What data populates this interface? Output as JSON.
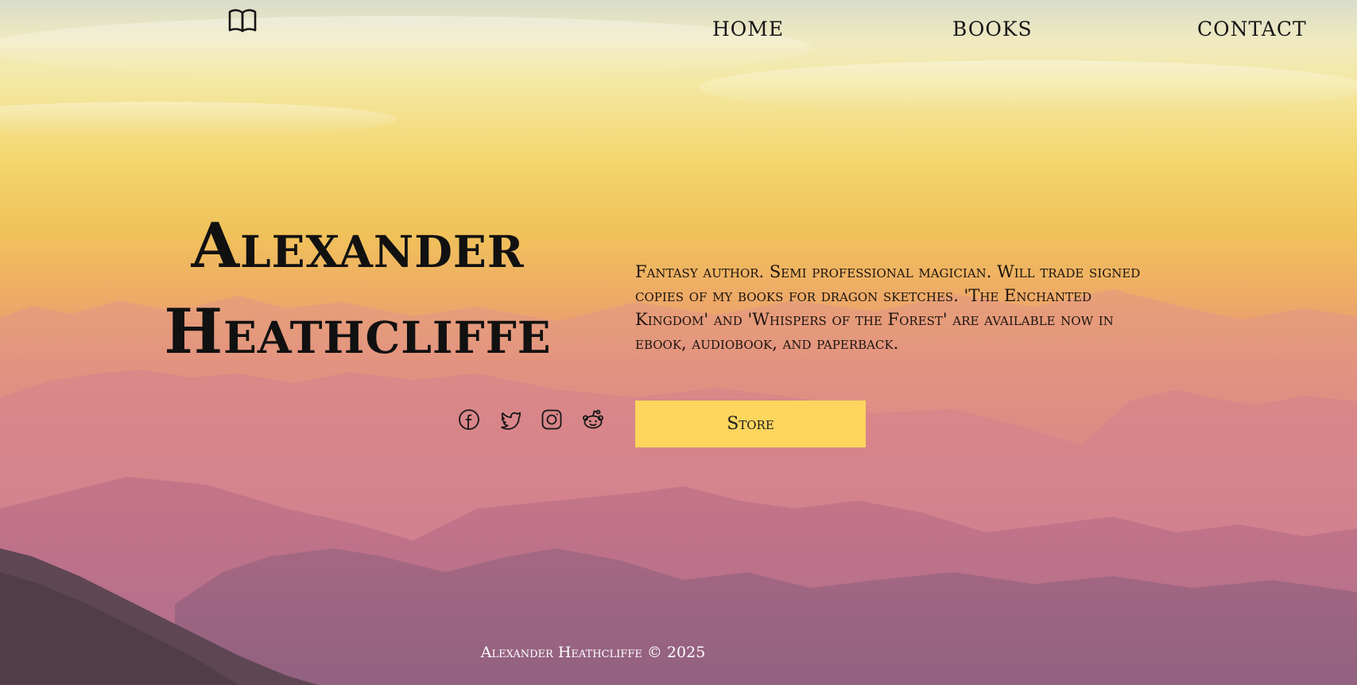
{
  "header": {
    "logo_icon": "open-book-icon",
    "nav": [
      {
        "label": "HOME"
      },
      {
        "label": "BOOKS"
      },
      {
        "label": "CONTACT"
      }
    ]
  },
  "hero": {
    "name_line1": "Alexander",
    "name_line2": "Heathcliffe",
    "bio": "Fantasy author. Semi professional magician. Will trade signed copies of my books for dragon sketches. 'The Enchanted Kingdom' and 'Whispers of the Forest' are available now in ebook, audiobook, and paperback.",
    "store_label": "Store",
    "socials": [
      "facebook-icon",
      "twitter-icon",
      "instagram-icon",
      "reddit-icon"
    ]
  },
  "footer": {
    "text": "Alexander Heathcliffe © 2025"
  },
  "colors": {
    "store_button": "#fed55d",
    "text": "#141414",
    "footer_text": "#ffffff"
  }
}
